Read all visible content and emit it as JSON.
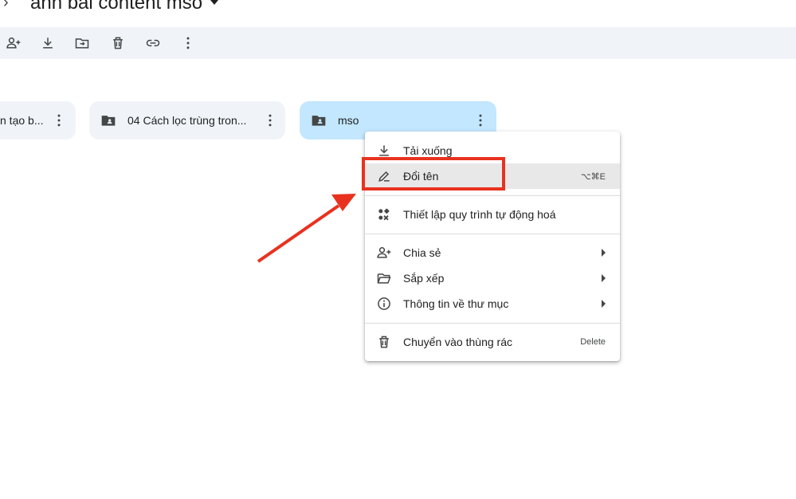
{
  "header": {
    "title": "anh bai content mso"
  },
  "toolbar": {
    "buttons": [
      "add-user-icon",
      "download-icon",
      "move-to-folder-icon",
      "trash-icon",
      "link-icon",
      "more-vert-icon"
    ]
  },
  "folders": [
    {
      "label": "n tạo b...",
      "selected": false
    },
    {
      "label": "04 Cách lọc trùng tron...",
      "selected": false
    },
    {
      "label": "mso",
      "selected": true
    }
  ],
  "context_menu": {
    "items": [
      {
        "label": "Tải xuống",
        "icon": "download-icon",
        "shortcut": "",
        "submenu": false
      },
      {
        "label": "Đổi tên",
        "icon": "pencil-icon",
        "shortcut": "⌥⌘E",
        "submenu": false,
        "highlighted": true
      },
      {
        "label": "Thiết lập quy trình tự động hoá",
        "icon": "workflow-icon",
        "shortcut": "",
        "submenu": false
      },
      {
        "label": "Chia sẻ",
        "icon": "share-person-icon",
        "shortcut": "",
        "submenu": true
      },
      {
        "label": "Sắp xếp",
        "icon": "folder-open-icon",
        "shortcut": "",
        "submenu": true
      },
      {
        "label": "Thông tin về thư mục",
        "icon": "info-icon",
        "shortcut": "",
        "submenu": true
      },
      {
        "label": "Chuyển vào thùng rác",
        "icon": "trash-icon",
        "shortcut": "Delete",
        "submenu": false
      }
    ]
  },
  "colors": {
    "toolbar_bg": "#f0f4f9",
    "selected_folder_bg": "#c2e7ff",
    "annotation_red": "#e8321f"
  }
}
